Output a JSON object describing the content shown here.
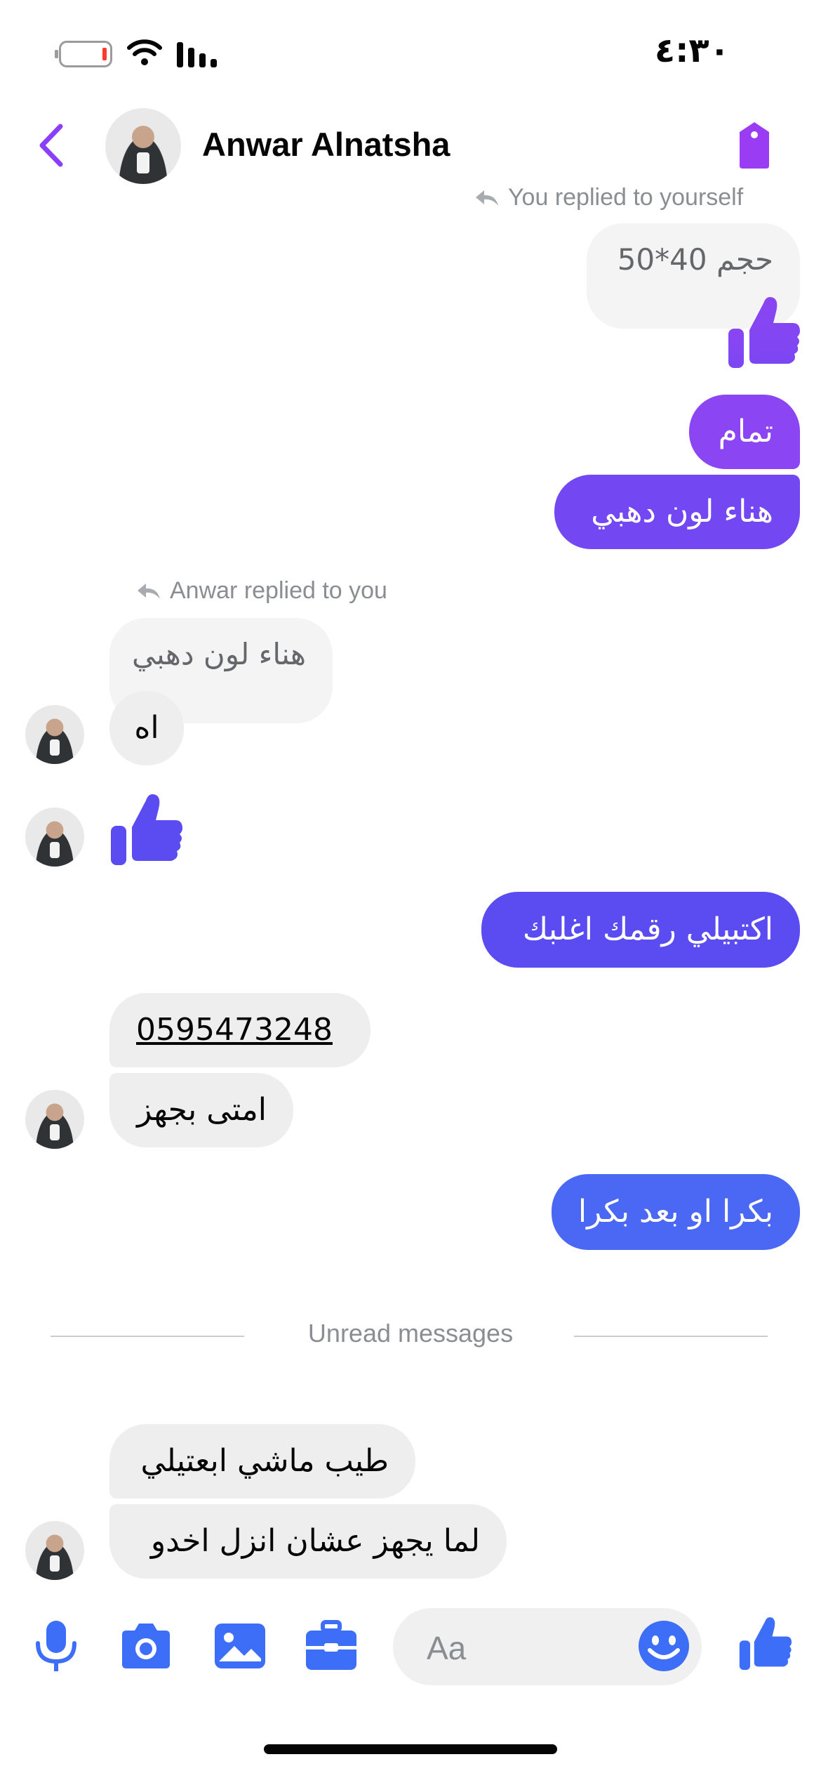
{
  "status_bar": {
    "time": "٤:٣٠"
  },
  "header": {
    "contact_name": "Anwar Alnatsha",
    "back_icon": "chevron-left-icon",
    "tag_icon": "tag-icon",
    "accent": "#8a3ffc"
  },
  "messages": {
    "reply_self": "You replied to yourself",
    "quoted_self": "حجم 40*50",
    "sent_1": "تمام",
    "sent_2": "هناء لون دهبي",
    "reply_anwar": "Anwar replied to you",
    "quoted_anwar": "هناء لون دهبي",
    "recv_1": "اه",
    "sent_3": "اكتبيلي رقمك اغلبك",
    "recv_phone": "0595473248",
    "recv_2": "امتى بجهز",
    "sent_4": "بكرا او بعد بكرا",
    "unread_label": "Unread messages",
    "recv_3": "طيب ماشي ابعتيلي",
    "recv_4": "لما يجهز عشان انزل اخدو"
  },
  "composer": {
    "placeholder": "Aa",
    "icons": [
      "microphone-icon",
      "camera-icon",
      "gallery-icon",
      "toolbox-icon",
      "emoji-icon",
      "like-icon"
    ],
    "accent": "#3d6ef7"
  },
  "colors": {
    "sent_purple": "#8b45f2",
    "sent_indigo": "#5b4cf0",
    "sent_blue": "#4a68f3",
    "received_gray": "#eeeeee"
  }
}
